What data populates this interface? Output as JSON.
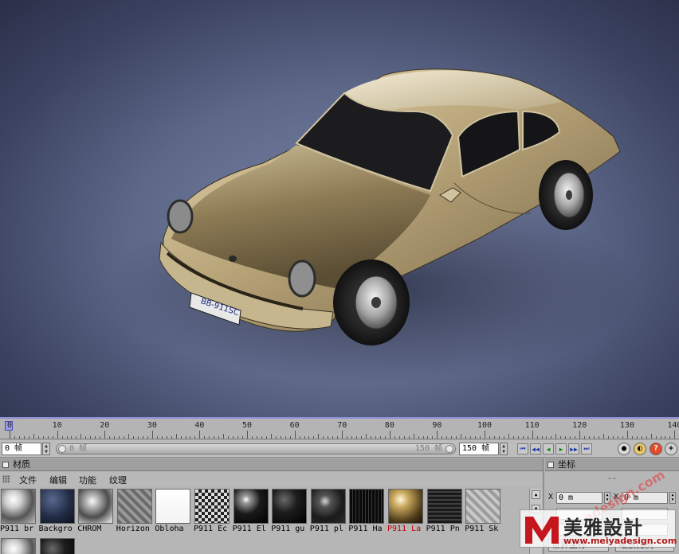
{
  "ruler": {
    "labels": [
      "0",
      "10",
      "20",
      "30",
      "40",
      "50",
      "60",
      "70",
      "80",
      "90",
      "100",
      "110",
      "120",
      "130",
      "140"
    ]
  },
  "transport": {
    "start_value": "0 帧",
    "range_lo": "0 帧",
    "range_hi": "150 帧",
    "end_value": "150 帧"
  },
  "materials_panel": {
    "title": "材质",
    "menu": [
      "文件",
      "编辑",
      "功能",
      "纹理"
    ],
    "materials": [
      {
        "name": "P911 br",
        "kind": "chrome-light",
        "highlight": false
      },
      {
        "name": "Backgro",
        "kind": "dark-blue",
        "highlight": false
      },
      {
        "name": "CHROM",
        "kind": "chrome",
        "highlight": false
      },
      {
        "name": "Horizon",
        "kind": "striped-dark",
        "highlight": false
      },
      {
        "name": "Obloha",
        "kind": "white",
        "highlight": false
      },
      {
        "name": "P911 Ec",
        "kind": "checker",
        "highlight": false
      },
      {
        "name": "P911 El",
        "kind": "black-glossy",
        "highlight": false
      },
      {
        "name": "P911 gu",
        "kind": "black",
        "highlight": false
      },
      {
        "name": "P911 pl",
        "kind": "dark-glossy",
        "highlight": false
      },
      {
        "name": "P911 Ha",
        "kind": "black-grid",
        "highlight": false
      },
      {
        "name": "P911 La",
        "kind": "gold",
        "highlight": true
      },
      {
        "name": "P911 Pn",
        "kind": "dark-stripes",
        "highlight": false
      },
      {
        "name": "P911 Sk",
        "kind": "striped-light",
        "highlight": false
      }
    ]
  },
  "coordinates_panel": {
    "title": "坐标",
    "subheader": "--",
    "rows": [
      {
        "axis": "X",
        "value": "0 m",
        "axis2": "X",
        "value2": "0 m"
      }
    ],
    "footer_left": "世界坐标",
    "footer_right": "缩放比例"
  },
  "watermark": {
    "brand": "美雅設計",
    "url": "www.meiyadesign.com",
    "diagonal": "meiyadesign.com"
  },
  "colors": {
    "ruler_accent": "#8f8fd8",
    "transport_blue": "#1a3aa8",
    "transport_green": "#1b8a1b",
    "highlight_red": "#c00000"
  },
  "icons": [
    "color-picker-icon",
    "help-icon"
  ]
}
